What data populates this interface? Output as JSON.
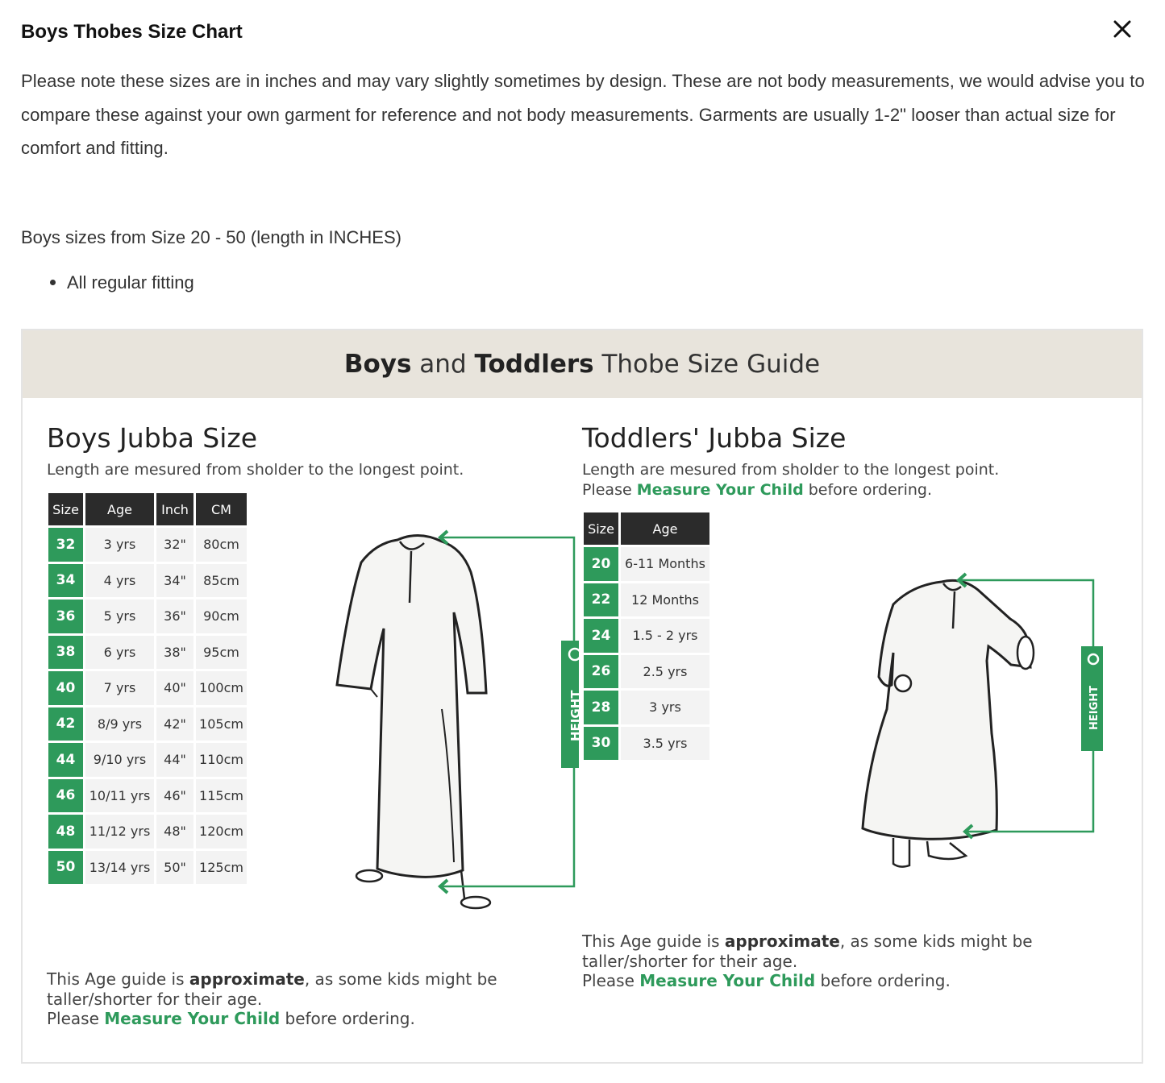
{
  "modal": {
    "title": "Boys Thobes Size Chart",
    "close_icon": "close-icon",
    "intro": "Please note these sizes are in inches and may vary slightly sometimes by design. These are not body measurements, we would advise you to compare these against your own garment for reference and not body measurements. Garments are usually 1-2\" looser than actual size for comfort and fitting.",
    "range_text": "Boys sizes from Size 20 - 50 (length in INCHES)",
    "bullets": [
      "All regular fitting"
    ]
  },
  "guide": {
    "header_bold_1": "Boys",
    "header_mid": " and ",
    "header_bold_2": "Toddlers",
    "header_rest": " Thobe Size Guide",
    "colors": {
      "accent_green": "#2e9a5b",
      "header_bg": "#e8e4dc",
      "table_header_bg": "#2b2b2b"
    },
    "boys": {
      "title": "Boys Jubba Size",
      "subtitle": "Length are mesured from sholder to the longest point.",
      "columns": [
        "Size",
        "Age",
        "Inch",
        "CM"
      ],
      "rows": [
        [
          "32",
          "3 yrs",
          "32\"",
          "80cm"
        ],
        [
          "34",
          "4 yrs",
          "34\"",
          "85cm"
        ],
        [
          "36",
          "5 yrs",
          "36\"",
          "90cm"
        ],
        [
          "38",
          "6 yrs",
          "38\"",
          "95cm"
        ],
        [
          "40",
          "7 yrs",
          "40\"",
          "100cm"
        ],
        [
          "42",
          "8/9 yrs",
          "42\"",
          "105cm"
        ],
        [
          "44",
          "9/10 yrs",
          "44\"",
          "110cm"
        ],
        [
          "46",
          "10/11 yrs",
          "46\"",
          "115cm"
        ],
        [
          "48",
          "11/12 yrs",
          "48\"",
          "120cm"
        ],
        [
          "50",
          "13/14 yrs",
          "50\"",
          "125cm"
        ]
      ],
      "height_label": "HEIGHT",
      "note_pre": "This Age guide is ",
      "note_bold": "approximate",
      "note_post": ", as some kids might be taller/shorter for their age.",
      "note_please": "Please ",
      "note_link": "Measure Your Child",
      "note_end": " before ordering."
    },
    "toddlers": {
      "title": "Toddlers' Jubba Size",
      "subtitle": "Length are mesured from sholder to the longest point.",
      "sub_please": "Please ",
      "sub_link": "Measure Your Child",
      "sub_end": " before ordering.",
      "columns": [
        "Size",
        "Age"
      ],
      "rows": [
        [
          "20",
          "6-11 Months"
        ],
        [
          "22",
          "12 Months"
        ],
        [
          "24",
          "1.5 - 2 yrs"
        ],
        [
          "26",
          "2.5 yrs"
        ],
        [
          "28",
          "3 yrs"
        ],
        [
          "30",
          "3.5 yrs"
        ]
      ],
      "height_label": "HEIGHT",
      "note_pre": "This Age guide is ",
      "note_bold": "approximate",
      "note_post": ", as some kids might be taller/shorter for their age.",
      "note_please": "Please ",
      "note_link": "Measure Your Child",
      "note_end": " before ordering."
    }
  }
}
